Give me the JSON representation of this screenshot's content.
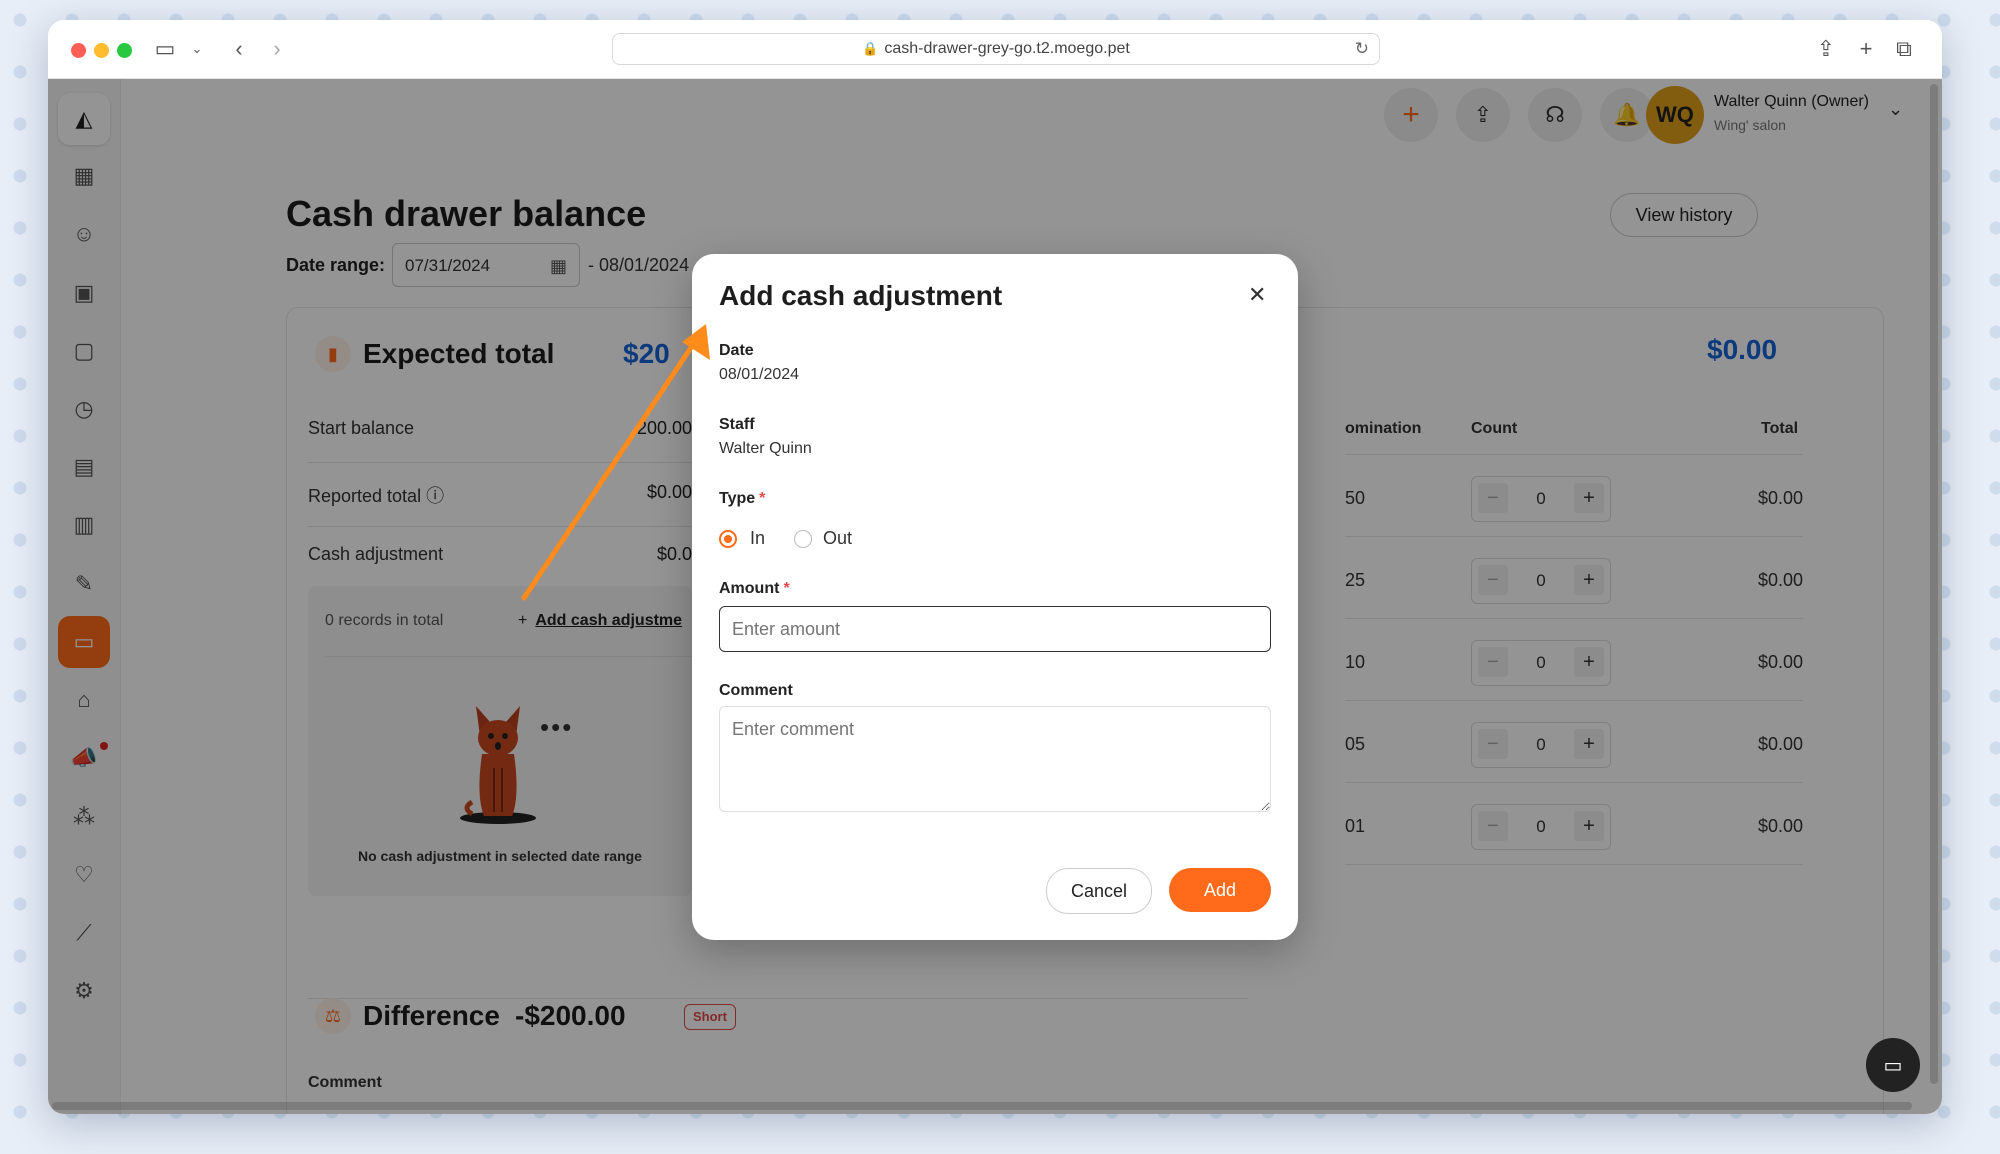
{
  "browser": {
    "url": "cash-drawer-grey-go.t2.moego.pet"
  },
  "user": {
    "initials": "WQ",
    "name": "Walter Quinn (Owner)",
    "org": "Wing' salon"
  },
  "page": {
    "title": "Cash drawer balance",
    "view_history": "View history",
    "date_range_label": "Date range:",
    "date_start": "07/31/2024",
    "date_end": "- 08/01/2024"
  },
  "expected": {
    "title": "Expected total",
    "amount": "$20",
    "rows": [
      {
        "label": "Start balance",
        "value": "200.00"
      },
      {
        "label": "Reported total",
        "value": "$0.00"
      },
      {
        "label": "Cash adjustment",
        "value": "$0.0"
      }
    ],
    "records": "0 records in total",
    "add_link": "Add cash adjustme",
    "empty_text": "No cash adjustment in selected date range"
  },
  "denomination": {
    "total_amount": "$0.00",
    "headers": [
      "omination",
      "Count",
      "Total"
    ],
    "rows": [
      {
        "den": "50",
        "count": "0",
        "total": "$0.00"
      },
      {
        "den": "25",
        "count": "0",
        "total": "$0.00"
      },
      {
        "den": "10",
        "count": "0",
        "total": "$0.00"
      },
      {
        "den": "05",
        "count": "0",
        "total": "$0.00"
      },
      {
        "den": "01",
        "count": "0",
        "total": "$0.00"
      }
    ]
  },
  "difference": {
    "title": "Difference",
    "amount": "-$200.00",
    "badge": "Short",
    "comment_label": "Comment"
  },
  "modal": {
    "title": "Add cash adjustment",
    "date_label": "Date",
    "date_value": "08/01/2024",
    "staff_label": "Staff",
    "staff_value": "Walter Quinn",
    "type_label": "Type",
    "type_in": "In",
    "type_out": "Out",
    "amount_label": "Amount",
    "amount_placeholder": "Enter amount",
    "comment_label": "Comment",
    "comment_placeholder": "Enter comment",
    "cancel": "Cancel",
    "add": "Add"
  },
  "colors": {
    "accent": "#ff6b1a",
    "blue": "#1565d8",
    "danger": "#e24b4b"
  }
}
